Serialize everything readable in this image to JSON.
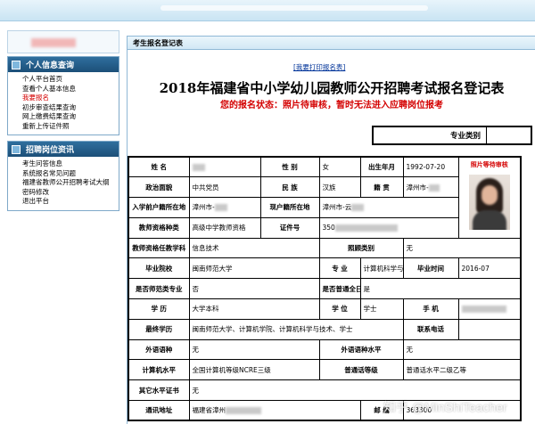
{
  "sidebar": {
    "personal": {
      "title": "个人信息查询",
      "items": [
        "个人平台首页",
        "查看个人基本信息",
        "我要报名",
        "初步审查结果查询",
        "网上缴费结果查询",
        "重新上传证件照"
      ],
      "active_index": 2
    },
    "jobs": {
      "title": "招聘岗位资讯",
      "items": [
        "考生问答信息",
        "系统报名常见问题",
        "福建省教师公开招聘考试大纲",
        "密码修改",
        "退出平台"
      ]
    }
  },
  "main": {
    "tab_title": "考生报名登记表",
    "print_link": "[我要打印报名表]",
    "form_title": "2018年福建省中小学幼儿园教师公开招聘考试报名登记表",
    "status": "您的报名状态：照片待审核，暂时无法进入应聘岗位报考",
    "category_label": "专业类别",
    "photo_status": "照片等待审核"
  },
  "form": {
    "name_label": "姓  名",
    "gender_label": "性  别",
    "gender": "女",
    "birth_label": "出生年月",
    "birth": "1992-07-20",
    "political_label": "政治面貌",
    "political": "中共党员",
    "ethnic_label": "民  族",
    "ethnic": "汉族",
    "native_label": "籍  贯",
    "native": "漳州市-",
    "hukou_label": "入学前户籍所在地",
    "hukou": "漳州市-",
    "cur_hukou_label": "现户籍所在地",
    "cur_hukou": "漳州市-云",
    "cert_type_label": "教师资格种类",
    "cert_type": "高级中学教师资格",
    "cert_no_label": "证件号",
    "cert_no": "350",
    "cert_subject_label": "教师资格任教学科",
    "cert_subject": "信息技术",
    "photo_label": "照顾类别",
    "photo_val": "无",
    "school_label": "毕业院校",
    "school": "闽南师范大学",
    "major_label": "专  业",
    "major": "计算机科学与技术",
    "grad_label": "毕业时间",
    "grad": "2016-07",
    "normal_label": "是否师范类专业",
    "normal": "否",
    "fulltime_label": "是否普通全日制",
    "fulltime": "是",
    "edu_label": "学  历",
    "edu": "大学本科",
    "degree_label": "学  位",
    "degree": "学士",
    "phone_label": "手  机",
    "final_edu_label": "最终学历",
    "final_edu": "闽南师范大学、计算机学院、计算机科学与技术、学士",
    "contact_label": "联系电话",
    "lang_label": "外语语种",
    "lang": "无",
    "lang_level_label": "外语语种水平",
    "lang_level": "无",
    "computer_label": "计算机水平",
    "computer": "全国计算机等级NCRE三级",
    "mandarin_label": "普通话等级",
    "mandarin": "普通话水平二级乙等",
    "other_label": "其它水平证书",
    "other": "无",
    "address_label": "通讯地址",
    "address": "福建省漳州",
    "postcode_label": "邮  编",
    "postcode": "363300"
  },
  "watermark": "知乎 @MinShiTeacher"
}
